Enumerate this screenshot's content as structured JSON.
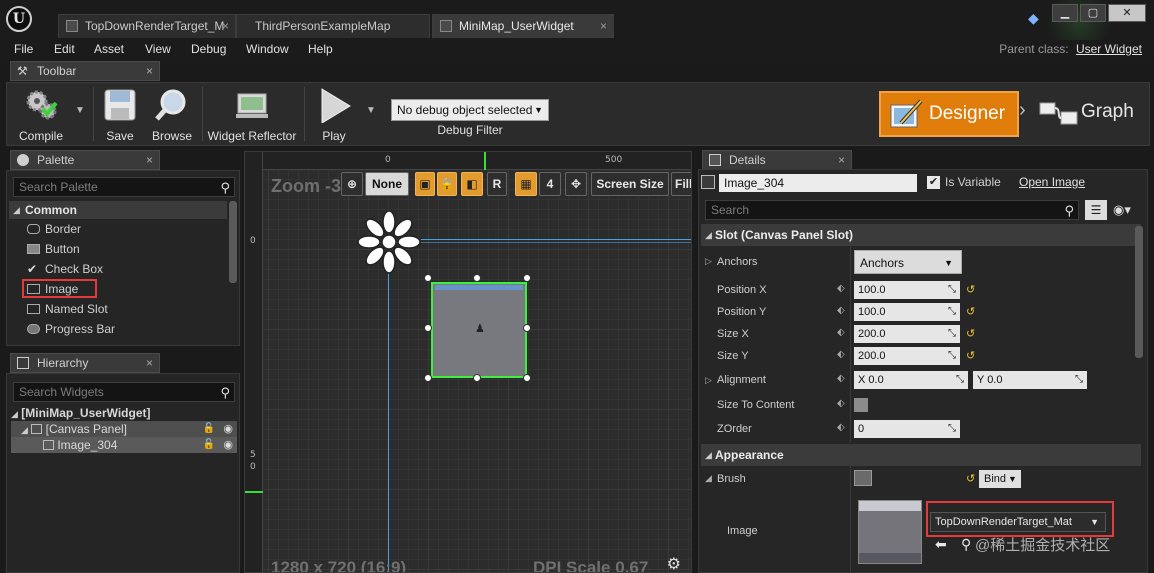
{
  "window": {
    "tabs": [
      {
        "label": "TopDownRenderTarget_M",
        "close": "×"
      },
      {
        "label": "ThirdPersonExampleMap",
        "close": ""
      },
      {
        "label": "MiniMap_UserWidget",
        "close": "×"
      }
    ],
    "buttons": {
      "minimize": "▁",
      "maximize": "▢",
      "close": "✕"
    }
  },
  "menu": {
    "items": [
      "File",
      "Edit",
      "Asset",
      "View",
      "Debug",
      "Window",
      "Help"
    ],
    "parent_class_label": "Parent class:",
    "parent_class_value": "User Widget"
  },
  "toolbar": {
    "tab_label": "Toolbar",
    "compile": "Compile",
    "save": "Save",
    "browse": "Browse",
    "widget_reflector": "Widget Reflector",
    "play": "Play",
    "debug_object": "No debug object selected",
    "debug_filter": "Debug Filter",
    "designer": "Designer",
    "graph": "Graph"
  },
  "palette": {
    "tab_label": "Palette",
    "search_placeholder": "Search Palette",
    "category": "Common",
    "items": [
      "Border",
      "Button",
      "Check Box",
      "Image",
      "Named Slot",
      "Progress Bar"
    ]
  },
  "hierarchy": {
    "tab_label": "Hierarchy",
    "search_placeholder": "Search Widgets",
    "root": "[MiniMap_UserWidget]",
    "canvas_panel": "[Canvas Panel]",
    "image": "Image_304"
  },
  "designer_canvas": {
    "zoom_label": "Zoom -3",
    "ruler_top": [
      "0",
      "500"
    ],
    "ruler_left": [
      "0",
      "5",
      "0"
    ],
    "anchor_option": "None",
    "grid_step": "4",
    "r_button": "R",
    "screen_size": "Screen Size",
    "fill": "Fill",
    "resolution": "1280 x 720 (16:9)",
    "dpi": "DPI Scale 0.67"
  },
  "details": {
    "tab_label": "Details",
    "widget_name": "Image_304",
    "is_variable_label": "Is Variable",
    "is_variable": true,
    "open_image": "Open Image",
    "search_placeholder": "Search",
    "slot_section": "Slot (Canvas Panel Slot)",
    "anchors_label": "Anchors",
    "anchors_value": "Anchors",
    "position_x_label": "Position X",
    "position_x": "100.0",
    "position_y_label": "Position Y",
    "position_y": "100.0",
    "size_x_label": "Size X",
    "size_x": "200.0",
    "size_y_label": "Size Y",
    "size_y": "200.0",
    "alignment_label": "Alignment",
    "alignment_x": "X  0.0",
    "alignment_y": "Y  0.0",
    "size_to_content_label": "Size To Content",
    "zorder_label": "ZOrder",
    "zorder": "0",
    "appearance_section": "Appearance",
    "brush_label": "Brush",
    "bind_label": "Bind",
    "image_label": "Image",
    "image_asset": "TopDownRenderTarget_Mat"
  },
  "watermark": "@稀土掘金技术社区",
  "colors": {
    "accent_orange": "#e07c0a",
    "highlight_red": "#e13b3b",
    "selection_green": "#3df03d",
    "guide_blue": "#4ab6ff"
  }
}
